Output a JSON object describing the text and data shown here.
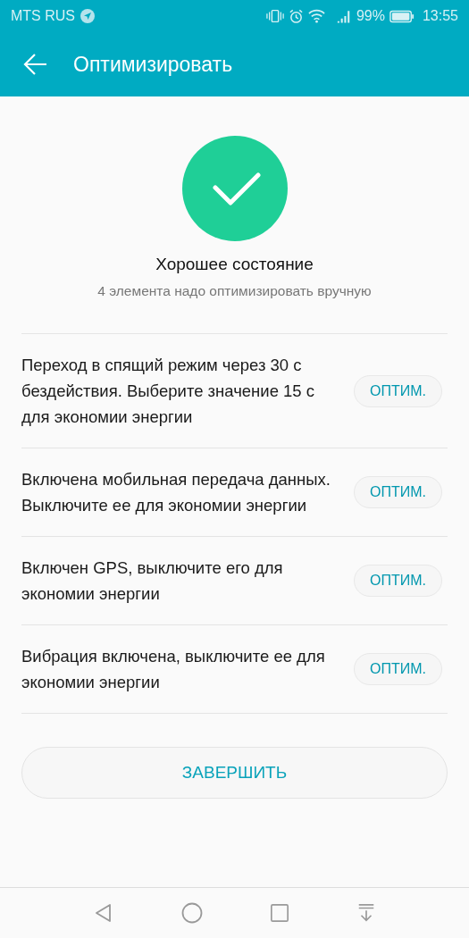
{
  "status_bar": {
    "carrier": "MTS RUS",
    "battery_percent": "99%",
    "time": "13:55"
  },
  "app_bar": {
    "title": "Оптимизировать"
  },
  "summary": {
    "title": "Хорошее состояние",
    "subtitle": "4 элемента надо оптимизировать вручную"
  },
  "items": [
    {
      "text": "Переход в спящий режим через 30 с бездействия. Выберите значение 15 с для экономии энергии",
      "button": "ОПТИМ."
    },
    {
      "text": "Включена мобильная передача данных. Выключите ее для экономии энергии",
      "button": "ОПТИМ."
    },
    {
      "text": "Включен GPS, выключите его для экономии энергии",
      "button": "ОПТИМ."
    },
    {
      "text": "Вибрация включена, выключите ее для экономии энергии",
      "button": "ОПТИМ."
    }
  ],
  "finish_button": "ЗАВЕРШИТЬ"
}
